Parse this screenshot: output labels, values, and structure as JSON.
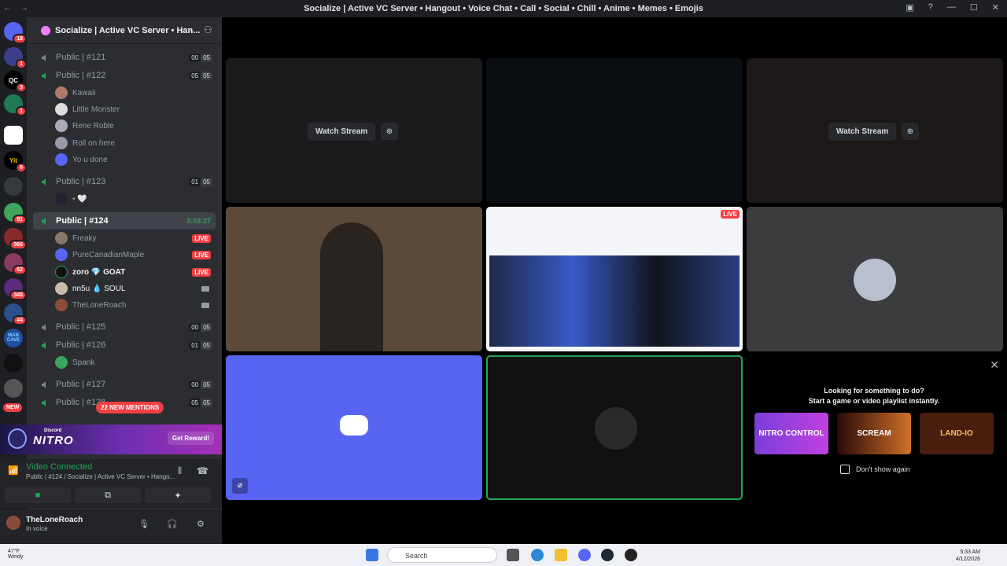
{
  "window": {
    "title": "Socialize | Active VC Server • Hangout • Voice Chat • Call • Social • Chill • Anime • Memes • Emojis"
  },
  "servers": [
    {
      "label": "",
      "badge": "18"
    },
    {
      "label": "",
      "badge": "1"
    },
    {
      "label": "QC",
      "badge": "3"
    },
    {
      "label": "",
      "badge": "1"
    },
    {
      "label": "",
      "badge": ""
    },
    {
      "label": "Yit",
      "badge": "6"
    },
    {
      "label": "",
      "badge": ""
    },
    {
      "label": "",
      "badge": "81"
    },
    {
      "label": "",
      "badge": "366"
    },
    {
      "label": "",
      "badge": "62"
    },
    {
      "label": "",
      "badge": "345"
    },
    {
      "label": "",
      "badge": "44"
    },
    {
      "label": "MAN CAVE",
      "badge": ""
    },
    {
      "label": "",
      "badge": ""
    },
    {
      "label": "",
      "badge": ""
    }
  ],
  "guild": {
    "name": "Socialize | Active VC Server • Han..."
  },
  "channels": [
    {
      "name": "Public | #121",
      "c1": "00",
      "c2": "05"
    },
    {
      "name": "Public | #122",
      "c1": "05",
      "c2": "05"
    },
    {
      "name": "Public | #123",
      "c1": "01",
      "c2": "05"
    },
    {
      "name": "Public | #124",
      "timer": "3:03:27"
    },
    {
      "name": "Public | #125",
      "c1": "00",
      "c2": "05"
    },
    {
      "name": "Public | #126",
      "c1": "01",
      "c2": "05"
    },
    {
      "name": "Public | #127",
      "c1": "00",
      "c2": "05"
    },
    {
      "name": "Public | #128",
      "c1": "05",
      "c2": "05"
    }
  ],
  "users": {
    "u122": [
      "Kawaii",
      "Little Monster",
      "Rene Roble",
      "Roll on here",
      "Yo u done"
    ],
    "u123": "• 🤍",
    "u124": [
      {
        "name": "Freaky",
        "live": "LIVE"
      },
      {
        "name": "PureCanadianMaple",
        "live": "LIVE"
      },
      {
        "name": "zoro 💎 GOAT",
        "live": "LIVE"
      },
      {
        "name": "nn5u 💧 SOUL"
      },
      {
        "name": "TheLoneRoach"
      }
    ],
    "u126": [
      "Spank"
    ]
  },
  "mentions": "22 NEW MENTIONS",
  "new": "NEW",
  "nitro": {
    "discord": "Discord",
    "title": "NITRO",
    "cta": "Get Reward!"
  },
  "voice": {
    "status": "Video Connected",
    "channel": "Public | #124 / Socialize | Active VC Server • Hango..."
  },
  "me": {
    "name": "TheLoneRoach",
    "status": "In voice"
  },
  "stage": {
    "watch": "Watch Stream",
    "live": "LIVE"
  },
  "activity": {
    "h1": "Looking for something to do?",
    "h2": "Start a game or video playlist instantly.",
    "cards": [
      "NITRO CONTROL",
      "SCREAM",
      "LAND-IO"
    ],
    "dont": "Don't show again"
  },
  "taskbar": {
    "temp": "47°F",
    "wx": "Windy",
    "search": "Search",
    "time": "5:33 AM",
    "date": "4/12/2026"
  },
  "colors": {
    "blurple": "#5865f2",
    "green": "#23a55a",
    "red": "#f23f43"
  }
}
